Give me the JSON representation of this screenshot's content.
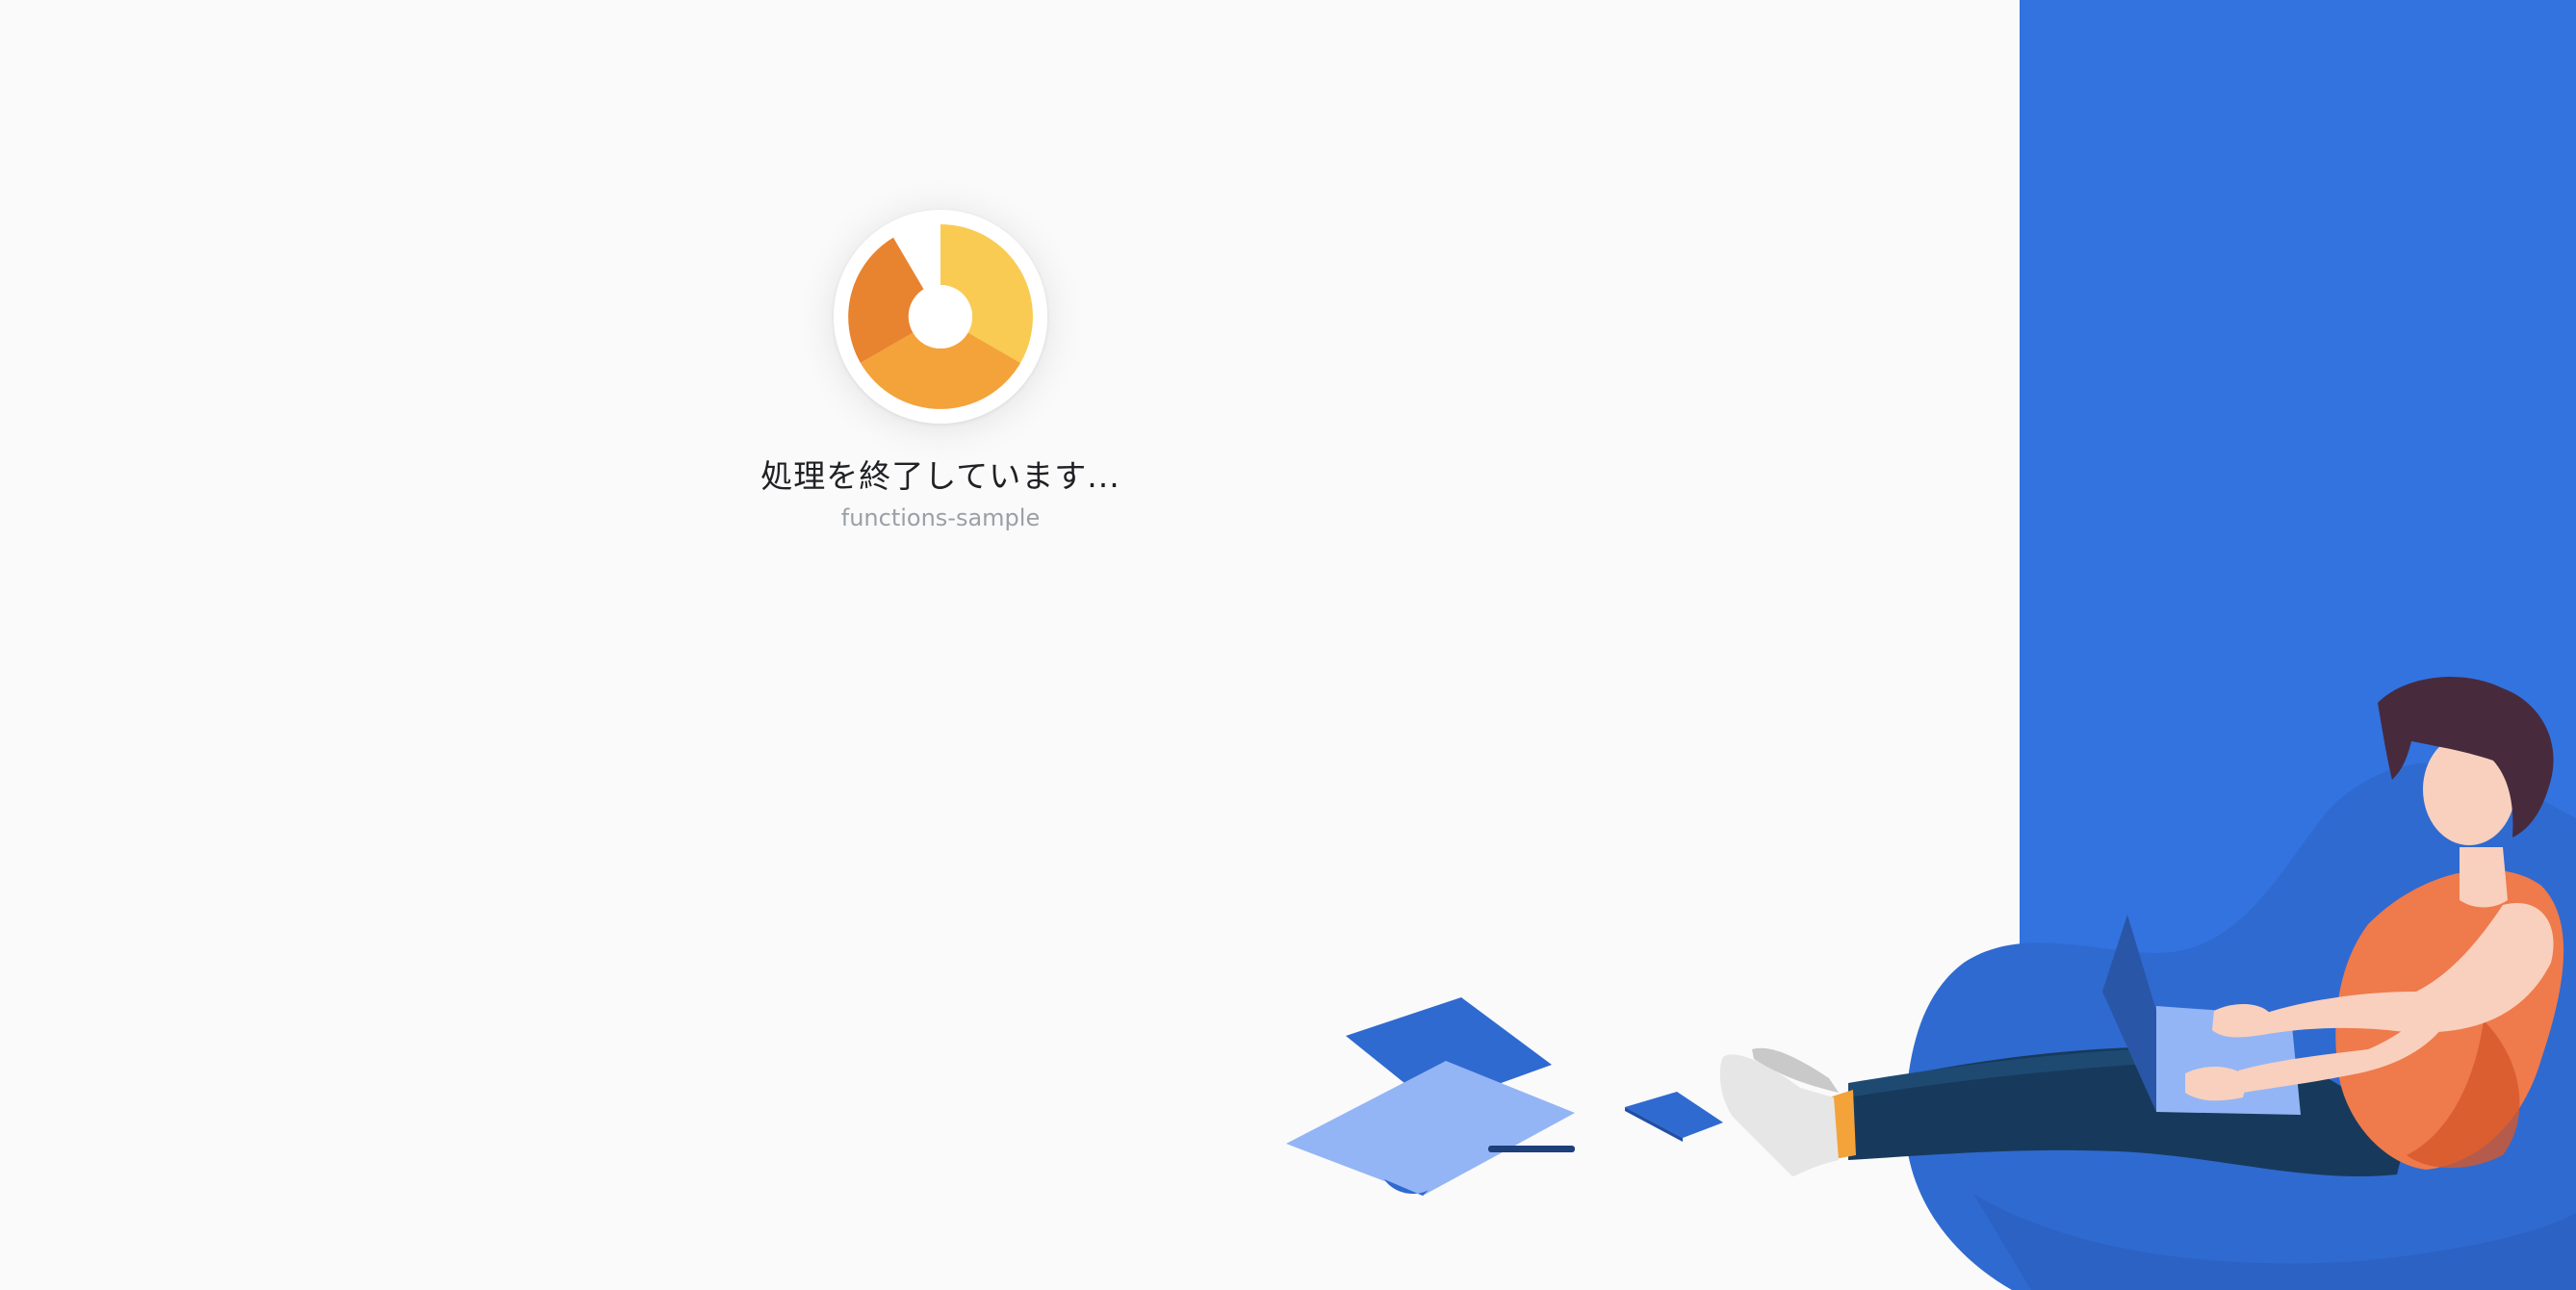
{
  "status": {
    "title": "処理を終了しています...",
    "project": "functions-sample"
  },
  "colors": {
    "background": "#fafafa",
    "panel": "#3273e0",
    "loader_yellow": "#f9cb52",
    "loader_orange": "#f4a23a",
    "loader_dark_orange": "#e8832f"
  },
  "icons": {
    "loader": "loading-spinner-icon",
    "illustration": "person-with-laptop-illustration"
  }
}
